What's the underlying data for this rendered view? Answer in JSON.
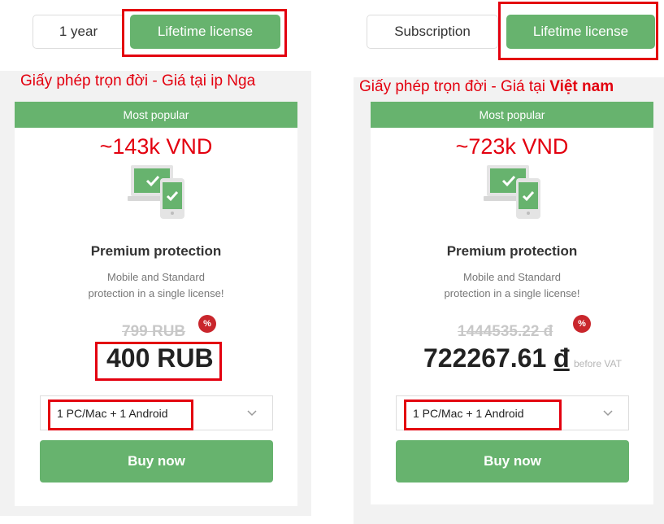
{
  "left": {
    "tabs": [
      {
        "label": "1 year",
        "active": false
      },
      {
        "label": "Lifetime license",
        "active": true
      }
    ],
    "caption": "Giấy phép trọn đời - Giá tại ip Nga",
    "card": {
      "badge": "Most popular",
      "approx_price": "~143k VND",
      "plan_name": "Premium protection",
      "description_line1": "Mobile and Standard",
      "description_line2": "protection in a single license!",
      "old_price": "799 RUB",
      "discount_badge": "%",
      "price": "400 RUB",
      "device_option": "1 PC/Mac + 1 Android",
      "buy_label": "Buy now"
    }
  },
  "right": {
    "tabs": [
      {
        "label": "Subscription",
        "active": false
      },
      {
        "label": "Lifetime license",
        "active": true
      }
    ],
    "caption_prefix": "Giấy phép trọn đời - Giá tại ",
    "caption_bold": "Việt nam",
    "card": {
      "badge": "Most popular",
      "approx_price": "~723k VND",
      "plan_name": "Premium protection",
      "description_line1": "Mobile and Standard",
      "description_line2": "protection in a single license!",
      "old_price": "1444535.22 đ",
      "discount_badge": "%",
      "price_value": "722267.61",
      "price_currency": "đ",
      "vat_note": "before VAT",
      "device_option": "1 PC/Mac + 1 Android",
      "buy_label": "Buy now"
    }
  },
  "colors": {
    "accent_green": "#67b36e",
    "highlight_red": "#e3000f",
    "discount_red": "#c9262c"
  },
  "icons": [
    "laptop-phone-check-icon",
    "percent-badge-icon",
    "chevron-down-icon"
  ]
}
